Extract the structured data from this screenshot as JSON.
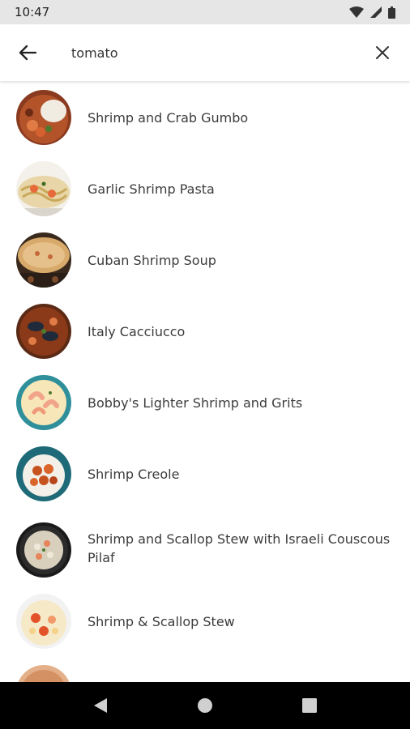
{
  "status": {
    "time": "10:47"
  },
  "search": {
    "query": "tomato"
  },
  "results": [
    {
      "title": "Shrimp and Crab Gumbo"
    },
    {
      "title": "Garlic Shrimp Pasta"
    },
    {
      "title": "Cuban Shrimp Soup"
    },
    {
      "title": "Italy Cacciucco"
    },
    {
      "title": "Bobby's Lighter Shrimp and Grits"
    },
    {
      "title": "Shrimp Creole"
    },
    {
      "title": "Shrimp and Scallop Stew with Israeli Couscous Pilaf"
    },
    {
      "title": "Shrimp & Scallop Stew"
    },
    {
      "title": ""
    }
  ],
  "colors": {
    "status_bar": "#e6e6e6",
    "nav_bar": "#000000",
    "text": "#3c3c3c"
  }
}
